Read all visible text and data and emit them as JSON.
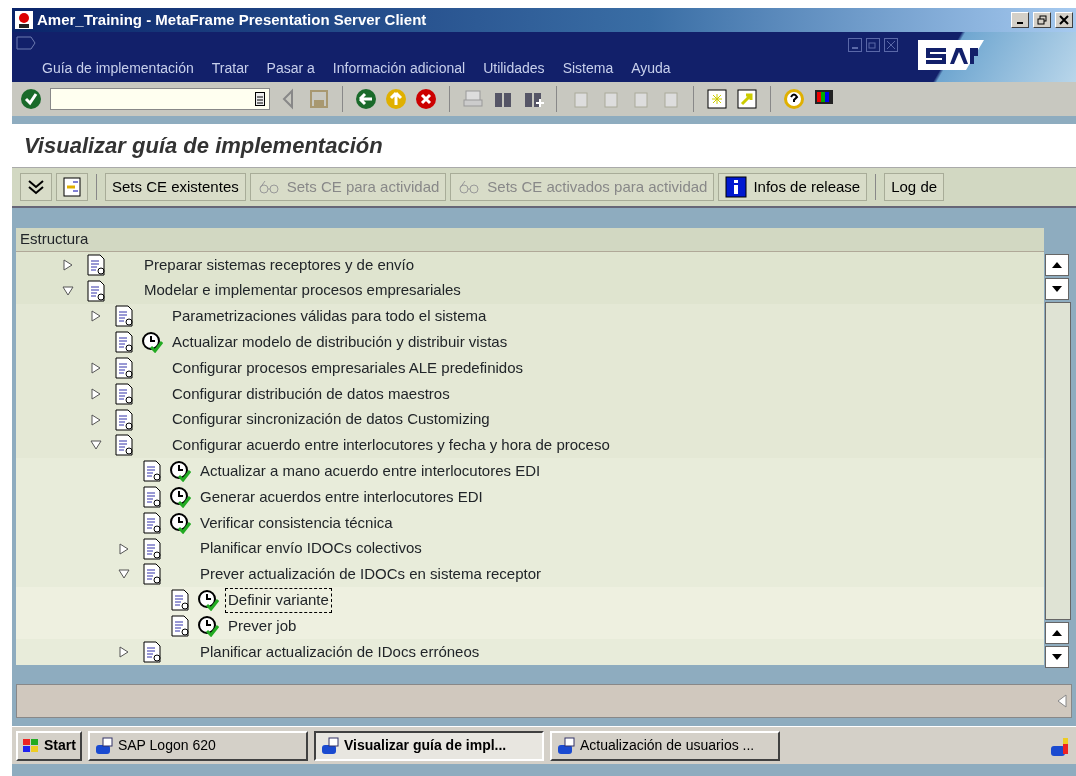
{
  "window": {
    "title": "Amer_Training - MetaFrame Presentation Server Client"
  },
  "menu": [
    {
      "label": "Guía de implementación"
    },
    {
      "label": "Tratar"
    },
    {
      "label": "Pasar a"
    },
    {
      "label": "Información adicional"
    },
    {
      "label": "Utilidades"
    },
    {
      "label": "Sistema"
    },
    {
      "label": "Ayuda"
    }
  ],
  "screen_title": "Visualizar guía de implementación",
  "app_toolbar": [
    {
      "kind": "text",
      "label": "Sets CE existentes",
      "disabled": false
    },
    {
      "kind": "glasses",
      "label": "Sets CE para actividad",
      "disabled": true
    },
    {
      "kind": "glasses",
      "label": "Sets CE activados para actividad",
      "disabled": true
    },
    {
      "kind": "info",
      "label": "Infos de release",
      "disabled": false
    },
    {
      "kind": "text",
      "label": "Log de",
      "disabled": false
    }
  ],
  "tree": {
    "header": "Estructura",
    "nodes": [
      {
        "kind": "folder",
        "label": "Preparar sistemas receptores y de envío",
        "expanded": false,
        "selected": false
      },
      {
        "kind": "folder",
        "label": "Modelar e implementar procesos empresariales",
        "expanded": true,
        "selected": false,
        "children": [
          {
            "kind": "folder",
            "label": "Parametrizaciones válidas para todo el sistema",
            "expanded": false,
            "selected": false
          },
          {
            "kind": "activity",
            "label": "Actualizar modelo de distribución y distribuir vistas",
            "selected": false
          },
          {
            "kind": "folder",
            "label": "Configurar procesos empresariales ALE predefinidos",
            "expanded": false,
            "selected": false
          },
          {
            "kind": "folder",
            "label": "Configurar distribución de datos maestros",
            "expanded": false,
            "selected": false
          },
          {
            "kind": "folder",
            "label": "Configurar sincronización de datos Customizing",
            "expanded": false,
            "selected": false
          },
          {
            "kind": "folder",
            "label": "Configurar acuerdo entre interlocutores y fecha y hora de proceso",
            "expanded": true,
            "selected": false,
            "children": [
              {
                "kind": "activity",
                "label": "Actualizar a mano acuerdo entre interlocutores EDI",
                "selected": false
              },
              {
                "kind": "activity",
                "label": "Generar acuerdos entre interlocutores EDI",
                "selected": false
              },
              {
                "kind": "activity",
                "label": "Verificar consistencia técnica",
                "selected": false
              },
              {
                "kind": "folder",
                "label": "Planificar envío IDOCs colectivos",
                "expanded": false,
                "selected": false
              },
              {
                "kind": "folder",
                "label": "Prever actualización de IDOCs en sistema receptor",
                "expanded": true,
                "selected": false,
                "children": [
                  {
                    "kind": "activity",
                    "label": "Definir variante",
                    "selected": true
                  },
                  {
                    "kind": "activity",
                    "label": "Prever job",
                    "selected": false
                  }
                ]
              },
              {
                "kind": "folder",
                "label": "Planificar actualización de IDocs erróneos",
                "expanded": false,
                "selected": false
              }
            ]
          }
        ]
      }
    ]
  },
  "taskbar": [
    {
      "kind": "start",
      "label": "Start",
      "selected": false
    },
    {
      "kind": "app",
      "label": "SAP Logon 620",
      "selected": false
    },
    {
      "kind": "app",
      "label": "Visualizar guía de impl...",
      "selected": true
    },
    {
      "kind": "app",
      "label": "Actualización de usuarios ...",
      "selected": false
    }
  ]
}
